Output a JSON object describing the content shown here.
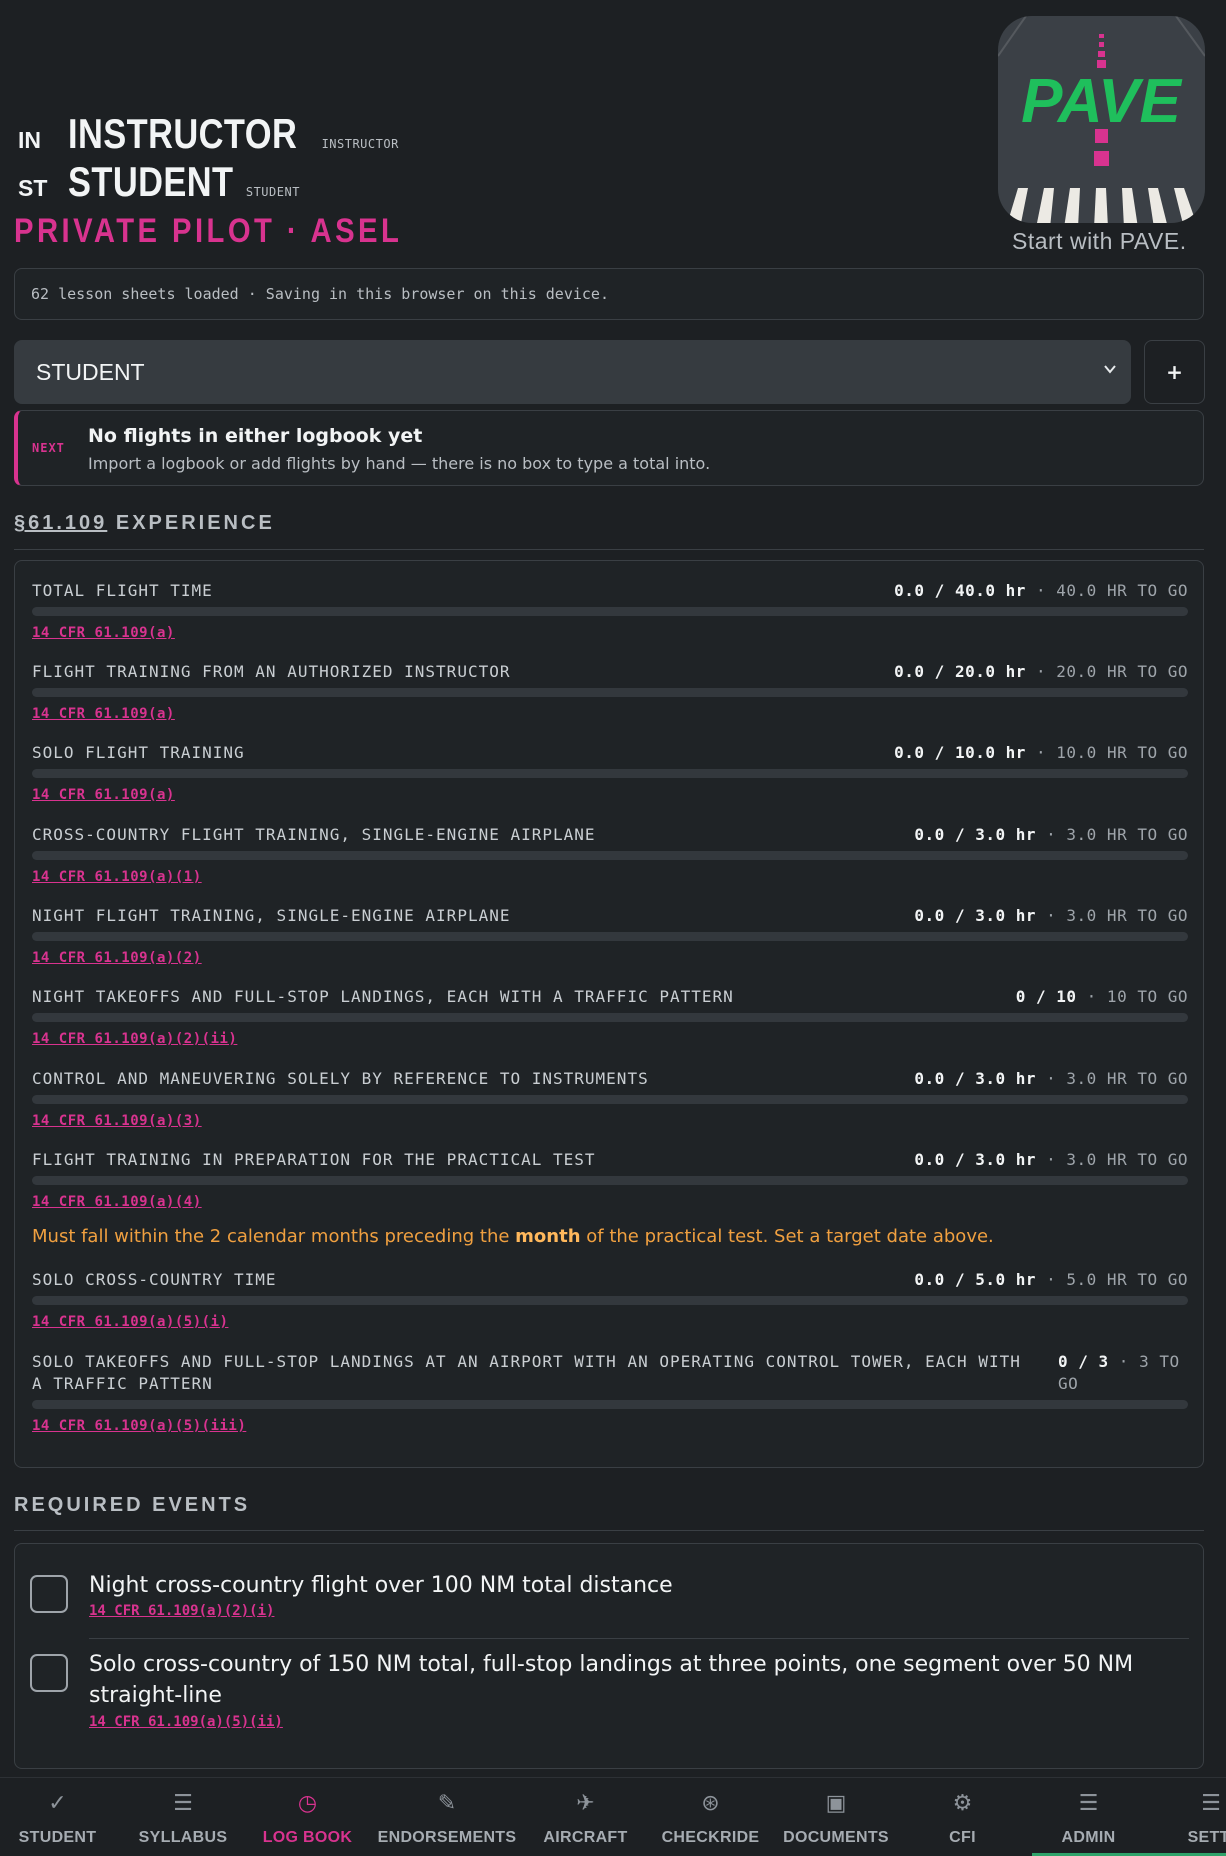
{
  "header": {
    "instructor_tag": "IN",
    "instructor_name": "INSTRUCTOR",
    "instructor_sub": "INSTRUCTOR",
    "student_tag": "ST",
    "student_name": "STUDENT",
    "student_sub": "STUDENT",
    "certificate": "PRIVATE PILOT · ASEL"
  },
  "logo": {
    "wordmark": "PAVE",
    "tagline": "Start with PAVE."
  },
  "status": "62 lesson sheets loaded · Saving in this browser on this device.",
  "student_select": {
    "value": "STUDENT",
    "add_label": "+"
  },
  "next": {
    "tag": "NEXT",
    "title": "No flights in either logbook yet",
    "subtitle": "Import a logbook or add flights by hand — there is no box to type a total into."
  },
  "experience": {
    "section_link": "§61.109",
    "section_title": " EXPERIENCE",
    "items": [
      {
        "label": "TOTAL FLIGHT TIME",
        "current": "0.0 / 40.0 hr",
        "togo": " · 40.0 HR TO GO",
        "progress": 0,
        "cite": "14 CFR 61.109(a)"
      },
      {
        "label": "FLIGHT TRAINING FROM AN AUTHORIZED INSTRUCTOR",
        "current": "0.0 / 20.0 hr",
        "togo": " · 20.0 HR TO GO",
        "progress": 0,
        "cite": "14 CFR 61.109(a)"
      },
      {
        "label": "SOLO FLIGHT TRAINING",
        "current": "0.0 / 10.0 hr",
        "togo": " · 10.0 HR TO GO",
        "progress": 0,
        "cite": "14 CFR 61.109(a)"
      },
      {
        "label": "CROSS-COUNTRY FLIGHT TRAINING, SINGLE-ENGINE AIRPLANE",
        "current": "0.0 / 3.0 hr",
        "togo": " · 3.0 HR TO GO",
        "progress": 0,
        "cite": "14 CFR 61.109(a)(1)"
      },
      {
        "label": "NIGHT FLIGHT TRAINING, SINGLE-ENGINE AIRPLANE",
        "current": "0.0 / 3.0 hr",
        "togo": " · 3.0 HR TO GO",
        "progress": 0,
        "cite": "14 CFR 61.109(a)(2)"
      },
      {
        "label": "NIGHT TAKEOFFS AND FULL-STOP LANDINGS, EACH WITH A TRAFFIC PATTERN",
        "current": "0 / 10",
        "togo": " · 10 TO GO",
        "progress": 0,
        "cite": "14 CFR 61.109(a)(2)(ii)"
      },
      {
        "label": "CONTROL AND MANEUVERING SOLELY BY REFERENCE TO INSTRUMENTS",
        "current": "0.0 / 3.0 hr",
        "togo": " · 3.0 HR TO GO",
        "progress": 0,
        "cite": "14 CFR 61.109(a)(3)"
      },
      {
        "label": "FLIGHT TRAINING IN PREPARATION FOR THE PRACTICAL TEST",
        "current": "0.0 / 3.0 hr",
        "togo": " · 3.0 HR TO GO",
        "progress": 0,
        "cite": "14 CFR 61.109(a)(4)"
      },
      {
        "label": "SOLO CROSS-COUNTRY TIME",
        "current": "0.0 / 5.0 hr",
        "togo": " · 5.0 HR TO GO",
        "progress": 0,
        "cite": "14 CFR 61.109(a)(5)(i)"
      },
      {
        "label": "SOLO TAKEOFFS AND FULL-STOP LANDINGS AT AN AIRPORT WITH AN OPERATING CONTROL TOWER, EACH WITH A TRAFFIC PATTERN",
        "current": "0 / 3",
        "togo": " · 3 TO GO",
        "progress": 0,
        "cite": "14 CFR 61.109(a)(5)(iii)"
      }
    ],
    "warning_pre": "Must fall within the 2 calendar months preceding the ",
    "warning_bold": "month",
    "warning_post": " of the practical test. Set a target date above."
  },
  "events": {
    "section_title": "REQUIRED EVENTS",
    "items": [
      {
        "title": "Night cross-country flight over 100 NM total distance",
        "cite": "14 CFR 61.109(a)(2)(i)",
        "checked": false
      },
      {
        "title": "Solo cross-country of 150 NM total, full-stop landings at three points, one segment over 50 NM straight-line",
        "cite": "14 CFR 61.109(a)(5)(ii)",
        "checked": false
      }
    ]
  },
  "nav": {
    "items": [
      {
        "label": "STUDENT",
        "icon": "checkmark-icon"
      },
      {
        "label": "SYLLABUS",
        "icon": "list-icon"
      },
      {
        "label": "LOG BOOK",
        "icon": "clock-icon"
      },
      {
        "label": "ENDORSEMENTS",
        "icon": "pen-icon"
      },
      {
        "label": "AIRCRAFT",
        "icon": "airplane-icon"
      },
      {
        "label": "CHECKRIDE",
        "icon": "steering-wheel-icon"
      },
      {
        "label": "DOCUMENTS",
        "icon": "document-icon"
      },
      {
        "label": "CFI",
        "icon": "gear-icon"
      },
      {
        "label": "ADMIN",
        "icon": "list-icon"
      },
      {
        "label": "SETTI",
        "icon": "menu-icon"
      }
    ],
    "active": "LOG BOOK"
  },
  "colors": {
    "accent": "#d8338f",
    "warning": "#f0a040",
    "logo_green": "#1fbf5c",
    "background": "#1d2023"
  }
}
